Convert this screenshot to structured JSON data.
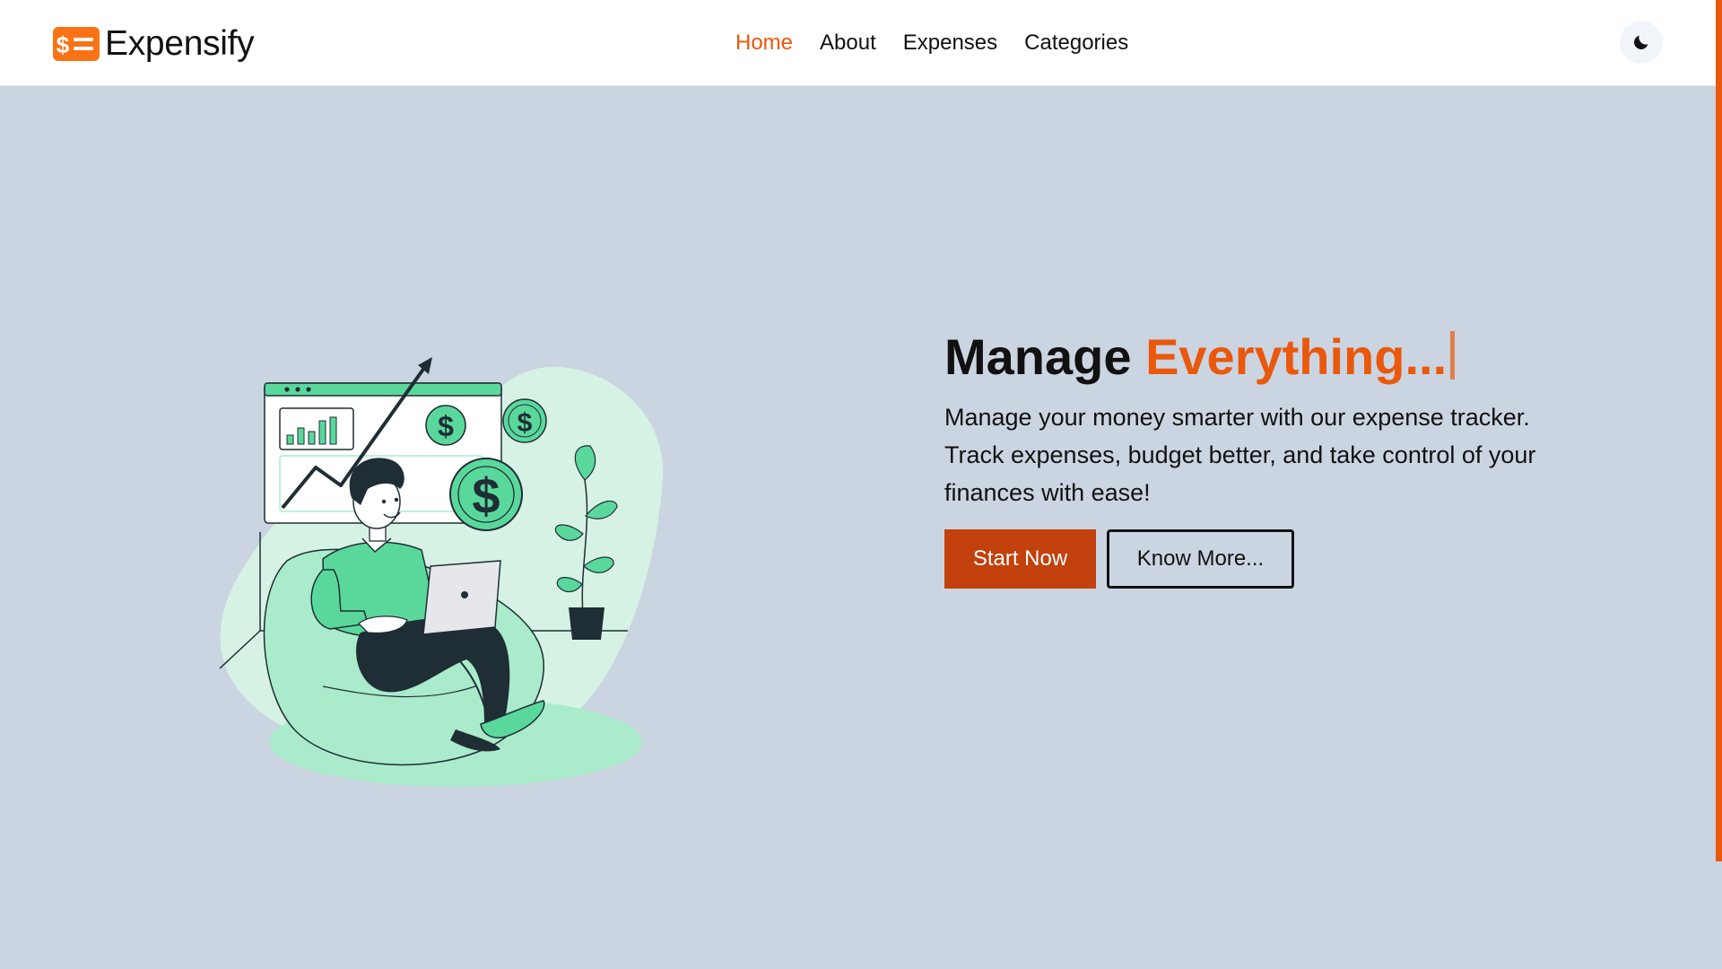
{
  "brand": {
    "name": "Expensify",
    "logo_icon": "dollar-list-icon",
    "logo_text": "$"
  },
  "nav": {
    "items": [
      {
        "label": "Home",
        "active": true
      },
      {
        "label": "About",
        "active": false
      },
      {
        "label": "Expenses",
        "active": false
      },
      {
        "label": "Categories",
        "active": false
      }
    ]
  },
  "theme_toggle": {
    "icon": "moon-icon"
  },
  "hero": {
    "title_plain": "Manage ",
    "title_accent": "Everything...",
    "description": "Manage your money smarter with our expense tracker. Track expenses, budget better, and take control of your finances with ease!",
    "primary_button": "Start Now",
    "secondary_button": "Know More...",
    "illustration": "person-on-beanbag-finance-illustration"
  },
  "colors": {
    "accent": "#ea580c",
    "primary_button": "#c2410c",
    "background": "#cbd5e1",
    "navbar": "#ffffff",
    "illustration_green": "#5ad89c",
    "illustration_dark": "#1f2d35"
  }
}
